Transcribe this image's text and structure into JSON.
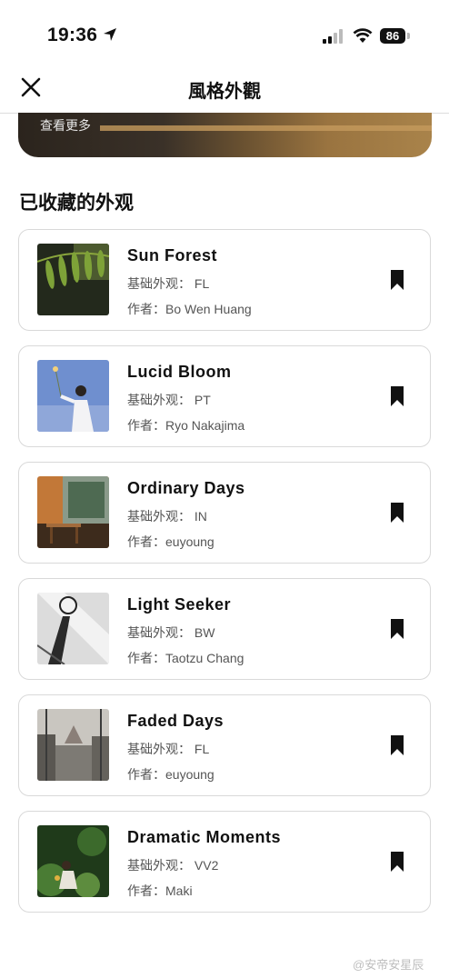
{
  "status": {
    "time": "19:36",
    "battery": "86"
  },
  "nav": {
    "title": "風格外觀"
  },
  "banner": {
    "more_label": "查看更多"
  },
  "section": {
    "title": "已收藏的外观"
  },
  "cards": [
    {
      "title": "Sun Forest",
      "base": "基础外观：  FL",
      "author": "作者：Bo Wen Huang"
    },
    {
      "title": "Lucid Bloom",
      "base": "基础外观：  PT",
      "author": "作者：Ryo Nakajima"
    },
    {
      "title": "Ordinary Days",
      "base": "基础外观：  IN",
      "author": "作者：euyoung"
    },
    {
      "title": "Light Seeker",
      "base": "基础外观：  BW",
      "author": "作者：Taotzu Chang"
    },
    {
      "title": "Faded Days",
      "base": "基础外观：  FL",
      "author": "作者：euyoung"
    },
    {
      "title": "Dramatic Moments",
      "base": "基础外观：  VV2",
      "author": "作者：Maki"
    }
  ],
  "watermark": "@安帝安星辰",
  "icons": {
    "close": "close-icon",
    "bookmark": "bookmark-filled-icon",
    "location": "location-arrow-icon",
    "signal": "cellular-signal-icon",
    "wifi": "wifi-icon",
    "battery": "battery-icon"
  }
}
